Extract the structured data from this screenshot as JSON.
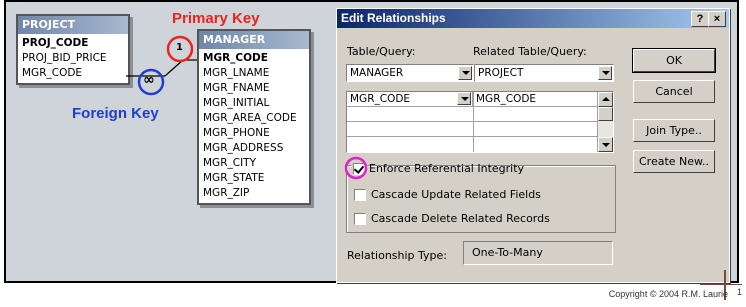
{
  "annotations": {
    "primary_key": "Primary Key",
    "foreign_key": "Foreign Key",
    "one_symbol": "1",
    "many_symbol": "∞"
  },
  "project_table": {
    "title": "PROJECT",
    "fields": [
      "PROJ_CODE",
      "PROJ_BID_PRICE",
      "MGR_CODE"
    ],
    "key_fields": [
      "PROJ_CODE"
    ]
  },
  "manager_table": {
    "title": "MANAGER",
    "fields": [
      "MGR_CODE",
      "MGR_LNAME",
      "MGR_FNAME",
      "MGR_INITIAL",
      "MGR_AREA_CODE",
      "MGR_PHONE",
      "MGR_ADDRESS",
      "MGR_CITY",
      "MGR_STATE",
      "MGR_ZIP"
    ]
  },
  "dialog": {
    "title": "Edit Relationships",
    "help_button": "?",
    "close_button": "×",
    "table_query_label": "Table/Query:",
    "related_table_query_label": "Related Table/Query:",
    "table_query_value": "MANAGER",
    "related_table_query_value": "PROJECT",
    "join_rows": [
      {
        "left": "MGR_CODE",
        "right": "MGR_CODE"
      }
    ],
    "buttons": {
      "ok": "OK",
      "cancel": "Cancel",
      "join_type": "Join Type..",
      "create_new": "Create New.."
    },
    "enforce_label": "Enforce Referential Integrity",
    "enforce_checked": true,
    "cascade_update_label": "Cascade Update Related Fields",
    "cascade_update_checked": false,
    "cascade_delete_label": "Cascade Delete Related Records",
    "cascade_delete_checked": false,
    "relationship_type_label": "Relationship Type:",
    "relationship_type_value": "One-To-Many"
  },
  "footer": {
    "copyright": "Copyright © 2004  R.M. Laurie",
    "page_number": "1"
  },
  "colors": {
    "annotation_red": "#e8241c",
    "annotation_blue": "#1f3fd0",
    "highlight_magenta": "#e020c8",
    "titlebar": "#0a246a"
  }
}
